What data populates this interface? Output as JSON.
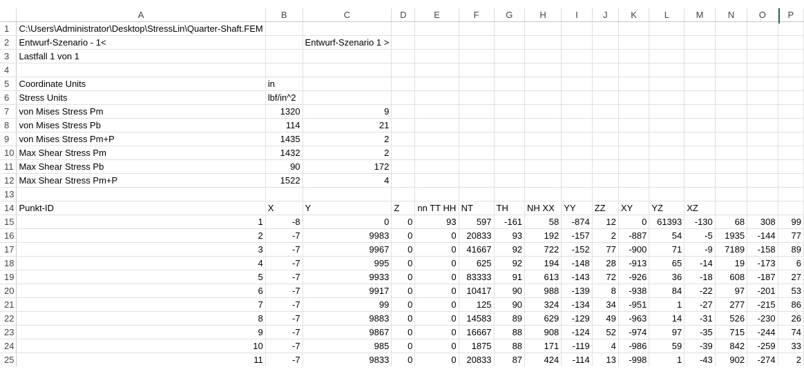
{
  "columns": [
    "A",
    "B",
    "C",
    "D",
    "E",
    "F",
    "G",
    "H",
    "I",
    "J",
    "K",
    "L",
    "M",
    "N",
    "O",
    "P"
  ],
  "rows": [
    {
      "n": "1",
      "cells": [
        {
          "c": 0,
          "t": "C:\\Users\\Administrator\\Desktop\\StressLin\\Quarter-Shaft.FEM",
          "k": "txt"
        }
      ]
    },
    {
      "n": "2",
      "cells": [
        {
          "c": 0,
          "t": "Entwurf-Szenario  - 1<",
          "k": "clip"
        },
        {
          "c": 2,
          "t": "Entwurf-Szenario 1 >",
          "k": "txt"
        }
      ]
    },
    {
      "n": "3",
      "cells": [
        {
          "c": 0,
          "t": "Lastfall 1 von 1",
          "k": "txt"
        }
      ]
    },
    {
      "n": "4",
      "cells": []
    },
    {
      "n": "5",
      "cells": [
        {
          "c": 0,
          "t": "Coordinate Units",
          "k": "txt"
        },
        {
          "c": 1,
          "t": "in",
          "k": "txt"
        }
      ]
    },
    {
      "n": "6",
      "cells": [
        {
          "c": 0,
          "t": "Stress Units",
          "k": "txt"
        },
        {
          "c": 1,
          "t": "lbf/in^2",
          "k": "txt"
        }
      ]
    },
    {
      "n": "7",
      "cells": [
        {
          "c": 0,
          "t": "von Mises Stress Pm",
          "k": "clip"
        },
        {
          "c": 1,
          "t": "1320",
          "k": "num"
        },
        {
          "c": 2,
          "t": "9",
          "k": "num"
        }
      ]
    },
    {
      "n": "8",
      "cells": [
        {
          "c": 0,
          "t": "von Mises Stress Pb",
          "k": "clip"
        },
        {
          "c": 1,
          "t": "114",
          "k": "num"
        },
        {
          "c": 2,
          "t": "21",
          "k": "num"
        }
      ]
    },
    {
      "n": "9",
      "cells": [
        {
          "c": 0,
          "t": "von Mises Stress Pm+P",
          "k": "clip"
        },
        {
          "c": 1,
          "t": "1435",
          "k": "num"
        },
        {
          "c": 2,
          "t": "2",
          "k": "num"
        }
      ]
    },
    {
      "n": "10",
      "cells": [
        {
          "c": 0,
          "t": "Max Shear Stress Pm",
          "k": "clip"
        },
        {
          "c": 1,
          "t": "1432",
          "k": "num"
        },
        {
          "c": 2,
          "t": "2",
          "k": "num"
        }
      ]
    },
    {
      "n": "11",
      "cells": [
        {
          "c": 0,
          "t": "Max Shear Stress Pb",
          "k": "clip"
        },
        {
          "c": 1,
          "t": "90",
          "k": "num"
        },
        {
          "c": 2,
          "t": "172",
          "k": "num"
        }
      ]
    },
    {
      "n": "12",
      "cells": [
        {
          "c": 0,
          "t": "Max Shear Stress Pm+P",
          "k": "clip"
        },
        {
          "c": 1,
          "t": "1522",
          "k": "num"
        },
        {
          "c": 2,
          "t": "4",
          "k": "num"
        }
      ]
    },
    {
      "n": "13",
      "cells": []
    },
    {
      "n": "14",
      "cells": [
        {
          "c": 0,
          "t": "Punkt-ID",
          "k": "clip"
        },
        {
          "c": 1,
          "t": "X",
          "k": "clip"
        },
        {
          "c": 2,
          "t": "Y",
          "k": "clip"
        },
        {
          "c": 3,
          "t": "Z",
          "k": "clip"
        },
        {
          "c": 4,
          "t": "nn TT HH",
          "k": "clip"
        },
        {
          "c": 5,
          "t": "NT",
          "k": "clip"
        },
        {
          "c": 6,
          "t": "TH",
          "k": "clip"
        },
        {
          "c": 7,
          "t": "NH XX",
          "k": "clip"
        },
        {
          "c": 8,
          "t": "YY",
          "k": "clip"
        },
        {
          "c": 9,
          "t": "ZZ",
          "k": "clip"
        },
        {
          "c": 10,
          "t": "XY",
          "k": "clip"
        },
        {
          "c": 11,
          "t": "YZ",
          "k": "clip"
        },
        {
          "c": 12,
          "t": "XZ",
          "k": "clip"
        }
      ]
    },
    {
      "n": "15",
      "vals": [
        "1",
        "-8",
        "0",
        "0",
        "93",
        "597",
        "-161",
        "58",
        "-874",
        "12",
        "0",
        "61393",
        "-130",
        "68",
        "308",
        "99"
      ]
    },
    {
      "n": "16",
      "vals": [
        "2",
        "-7",
        "9983",
        "0",
        "0",
        "20833",
        "93",
        "192",
        "-157",
        "2",
        "-887",
        "54",
        "-5",
        "1935",
        "-144",
        "77"
      ]
    },
    {
      "n": "17",
      "vals": [
        "3",
        "-7",
        "9967",
        "0",
        "0",
        "41667",
        "92",
        "722",
        "-152",
        "77",
        "-900",
        "71",
        "-9",
        "7189",
        "-158",
        "89"
      ]
    },
    {
      "n": "18",
      "vals": [
        "4",
        "-7",
        "995",
        "0",
        "0",
        "625",
        "92",
        "194",
        "-148",
        "28",
        "-913",
        "65",
        "-14",
        "19",
        "-173",
        "6"
      ]
    },
    {
      "n": "19",
      "vals": [
        "5",
        "-7",
        "9933",
        "0",
        "0",
        "83333",
        "91",
        "613",
        "-143",
        "72",
        "-926",
        "36",
        "-18",
        "608",
        "-187",
        "27"
      ]
    },
    {
      "n": "20",
      "vals": [
        "6",
        "-7",
        "9917",
        "0",
        "0",
        "10417",
        "90",
        "988",
        "-139",
        "8",
        "-938",
        "84",
        "-22",
        "97",
        "-201",
        "53"
      ]
    },
    {
      "n": "21",
      "vals": [
        "7",
        "-7",
        "99",
        "0",
        "0",
        "125",
        "90",
        "324",
        "-134",
        "34",
        "-951",
        "1",
        "-27",
        "277",
        "-215",
        "86"
      ]
    },
    {
      "n": "22",
      "vals": [
        "8",
        "-7",
        "9883",
        "0",
        "0",
        "14583",
        "89",
        "629",
        "-129",
        "49",
        "-963",
        "14",
        "-31",
        "526",
        "-230",
        "26"
      ]
    },
    {
      "n": "23",
      "vals": [
        "9",
        "-7",
        "9867",
        "0",
        "0",
        "16667",
        "88",
        "908",
        "-124",
        "52",
        "-974",
        "97",
        "-35",
        "715",
        "-244",
        "74"
      ]
    },
    {
      "n": "24",
      "vals": [
        "10",
        "-7",
        "985",
        "0",
        "0",
        "1875",
        "88",
        "171",
        "-119",
        "4",
        "-986",
        "59",
        "-39",
        "842",
        "-259",
        "33"
      ]
    },
    {
      "n": "25",
      "vals": [
        "11",
        "-7",
        "9833",
        "0",
        "0",
        "20833",
        "87",
        "424",
        "-114",
        "13",
        "-998",
        "1",
        "-43",
        "902",
        "-274",
        "2"
      ]
    }
  ]
}
